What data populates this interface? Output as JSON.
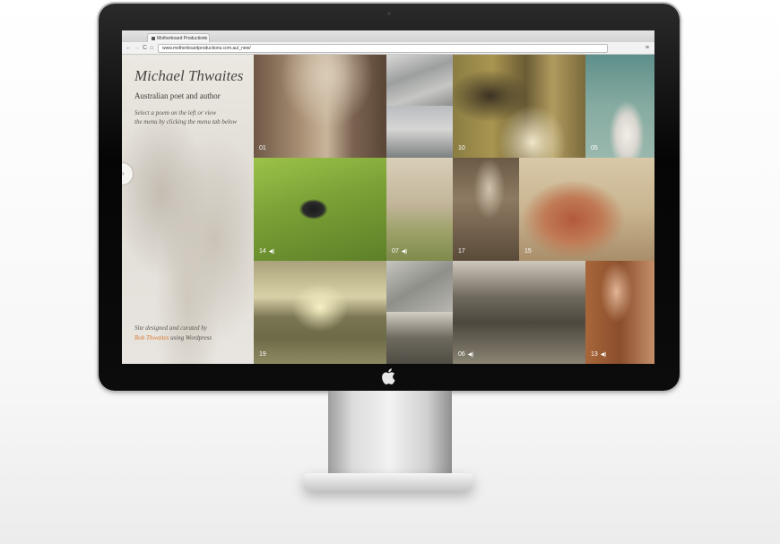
{
  "browser": {
    "tab_title": "Motherboard Productions",
    "tab_close": "×",
    "url": "www.motherboardproductions.com.au/_new/",
    "back": "←",
    "forward": "→",
    "reload": "C",
    "home": "⌂",
    "menu": "≡"
  },
  "sidebar": {
    "title": "Michael Thwaites",
    "subtitle": "Australian poet and author",
    "intro_line1": "Select a poem on the left  or view",
    "intro_line2": "the menu by clicking the menu tab below",
    "credit_line1": "Site designed and curated by",
    "credit_link": "Rob Thwaites",
    "credit_rest": " using Wordpress",
    "menu_tab_arrow": "›"
  },
  "tiles": [
    {
      "label": "01",
      "audio": false,
      "theme": "mountain-gorge"
    },
    {
      "label": "",
      "audio": false,
      "theme": "sheets-sky"
    },
    {
      "label": "10",
      "audio": false,
      "theme": "bathroom-mirror"
    },
    {
      "label": "05",
      "audio": false,
      "theme": "airplane-sky"
    },
    {
      "label": "14",
      "audio": true,
      "theme": "magpie-grass"
    },
    {
      "label": "07",
      "audio": true,
      "theme": "war-graves"
    },
    {
      "label": "17",
      "audio": false,
      "theme": "writing-desk"
    },
    {
      "label": "15",
      "audio": false,
      "theme": "rock-outcrop"
    },
    {
      "label": "19",
      "audio": false,
      "theme": "sunset-valley"
    },
    {
      "label": "",
      "audio": false,
      "theme": "road-house"
    },
    {
      "label": "06",
      "audio": true,
      "theme": "forest-trees"
    },
    {
      "label": "13",
      "audio": true,
      "theme": "portrait-man"
    }
  ],
  "icons": {
    "speaker": "speaker-icon",
    "apple": "apple-logo-icon"
  },
  "colors": {
    "credit_link": "#d9782f",
    "bezel": "#0c0c0c"
  }
}
